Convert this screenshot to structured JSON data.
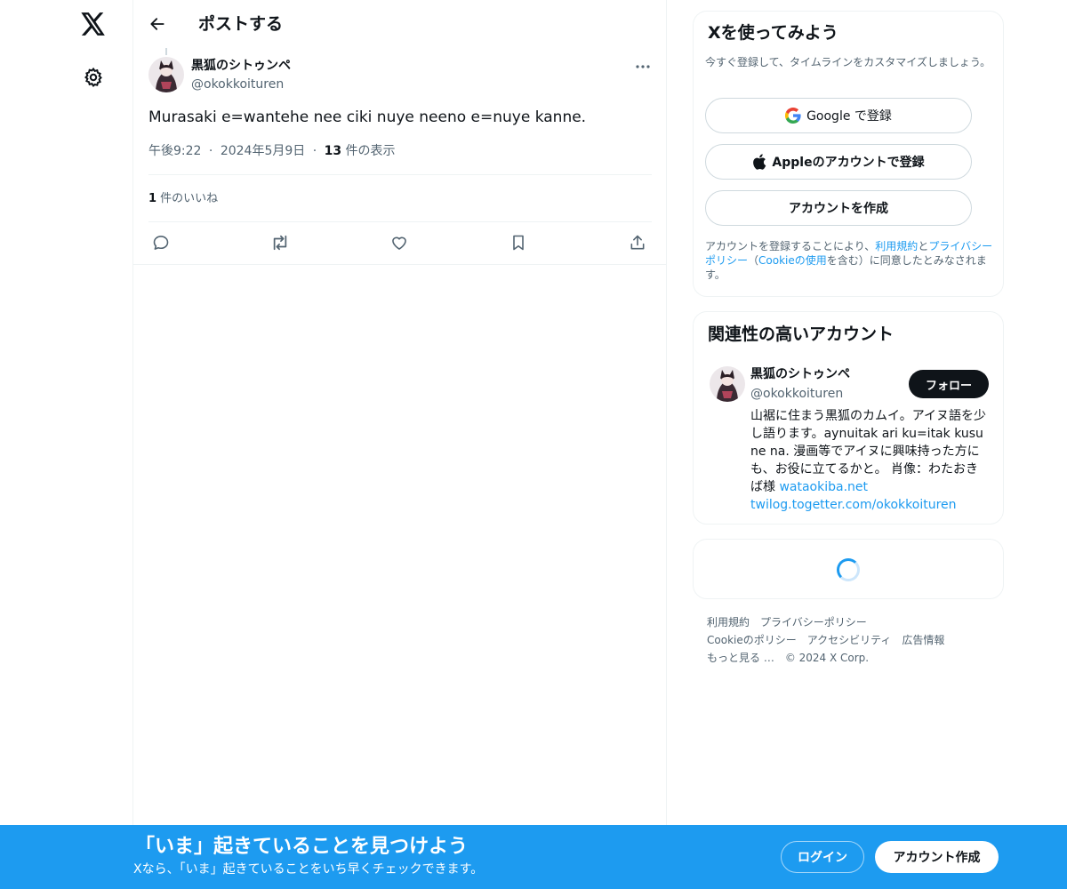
{
  "nav": {
    "logo_icon": "x-logo-icon",
    "settings_icon": "gear-icon"
  },
  "header": {
    "title": "ポストする",
    "back_icon": "arrow-left-icon"
  },
  "post": {
    "author_name": "黒狐のシトゥンペ",
    "author_handle": "@okokkoituren",
    "text": "Murasaki e=wantehe nee ciki nuye neeno e=nuye kanne.",
    "time": "午後9:22",
    "separator": "·",
    "date": "2024年5月9日",
    "views_count": "13",
    "views_label": " 件の表示",
    "likes_count": "1",
    "likes_label": " 件のいいね",
    "actions": [
      "reply-icon",
      "repost-icon",
      "like-icon",
      "bookmark-icon",
      "share-icon"
    ]
  },
  "signup": {
    "title": "Xを使ってみよう",
    "subtitle": "今すぐ登録して、タイムラインをカスタマイズしましょう。",
    "google_label": "Google で登録",
    "apple_label": "Appleのアカウントで登録",
    "create_label": "アカウントを作成",
    "legal_prefix": "アカウントを登録することにより、",
    "legal_terms": "利用規約",
    "legal_and": "と",
    "legal_privacy": "プライバシーポリシー",
    "legal_paren_open": "（",
    "legal_cookie": "Cookieの使用",
    "legal_suffix": "を含む）に同意したとみなされます。"
  },
  "related": {
    "title": "関連性の高いアカウント",
    "name": "黒狐のシトゥンペ",
    "handle": "@okokkoituren",
    "follow_label": "フォロー",
    "bio_text": "山裾に住まう黒狐のカムイ。アイヌ語を少し語ります。aynuitak ari ku=itak kusu ne na. 漫画等でアイヌに興味持った方にも、お役に立てるかと。 肖像：わたおきば様 ",
    "bio_link1": "wataokiba.net",
    "bio_link2": "twilog.togetter.com/okokkoituren"
  },
  "footer": {
    "terms": "利用規約",
    "privacy": "プライバシーポリシー",
    "cookie": "Cookieのポリシー",
    "accessibility": "アクセシビリティ",
    "ads": "広告情報",
    "more": "もっと見る …",
    "copyright": "© 2024 X Corp."
  },
  "banner": {
    "title": "「いま」起きていることを見つけよう",
    "subtitle": "Xなら、「いま」起きていることをいち早くチェックできます。",
    "login_label": "ログイン",
    "create_label": "アカウント作成"
  },
  "colors": {
    "accent": "#1d9bf0",
    "text": "#0f1419",
    "muted": "#536471",
    "border": "#eff3f4"
  }
}
